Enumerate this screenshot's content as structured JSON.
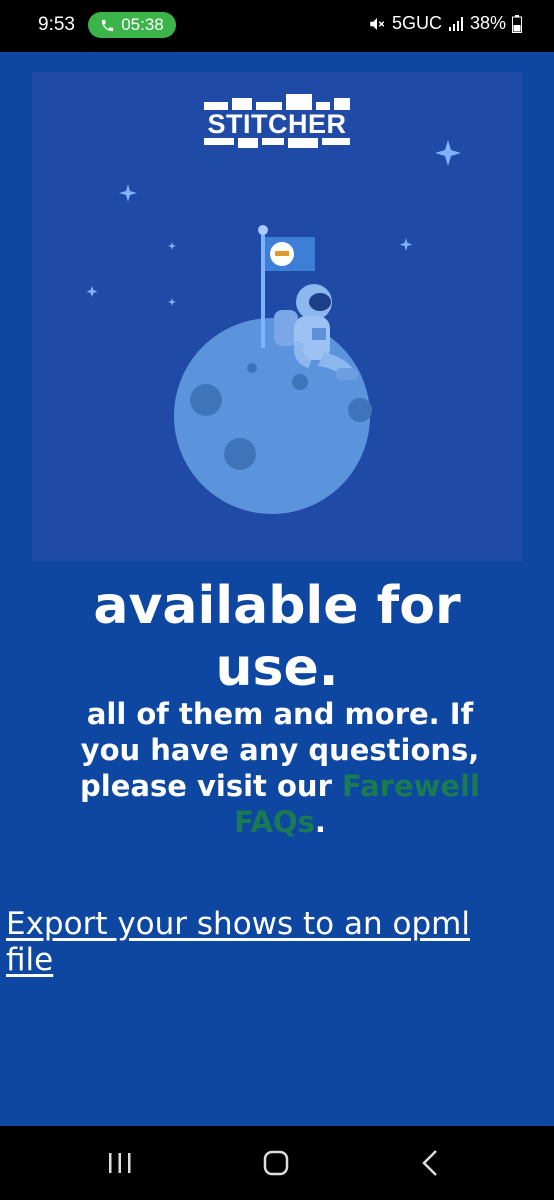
{
  "status_bar": {
    "time": "9:53",
    "call_duration": "05:38",
    "network": "5GUC",
    "battery": "38%"
  },
  "hero": {
    "logo_text": "STITCHER"
  },
  "content": {
    "headline_line1": "available for",
    "headline_line2": "use.",
    "body_before_link": "all of them and more. If you have any questions, please visit our ",
    "faq_link": "Farewell FAQs",
    "body_after_link": ".",
    "export_link": "Export your shows to an opml file"
  },
  "colors": {
    "background": "#0d47a1",
    "hero_bg": "#1f4aa6",
    "link_green": "#1a7a52",
    "call_green": "#3bb54a"
  }
}
